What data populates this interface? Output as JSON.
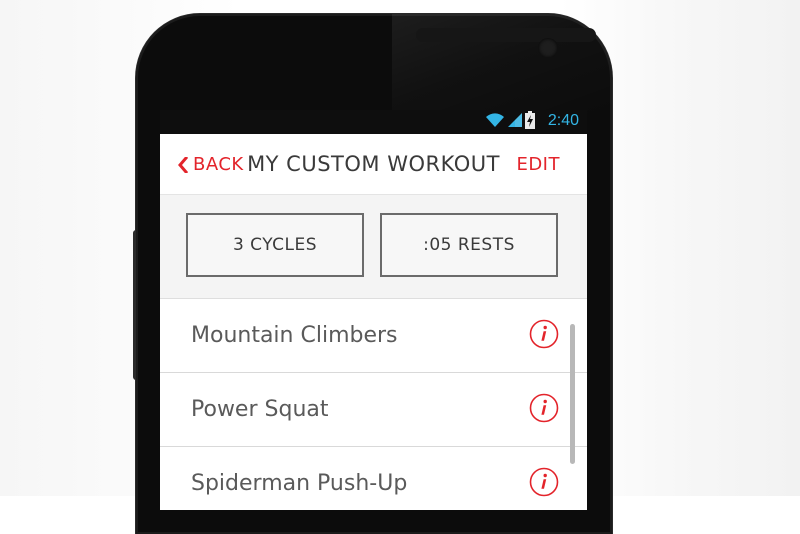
{
  "status_bar": {
    "time": "2:40",
    "icons": [
      "wifi-icon",
      "signal-icon",
      "battery-icon"
    ],
    "accent_color": "#33b5e5"
  },
  "header": {
    "back_label": "BACK",
    "title": "MY CUSTOM WORKOUT",
    "edit_label": "EDIT",
    "accent_color": "#e3242b"
  },
  "settings": {
    "cycles_label": "3 CYCLES",
    "rests_label": ":05 RESTS"
  },
  "exercises": [
    {
      "name": "Mountain Climbers",
      "icon": "info-icon"
    },
    {
      "name": "Power Squat",
      "icon": "info-icon"
    },
    {
      "name": "Spiderman Push-Up",
      "icon": "info-icon"
    }
  ]
}
